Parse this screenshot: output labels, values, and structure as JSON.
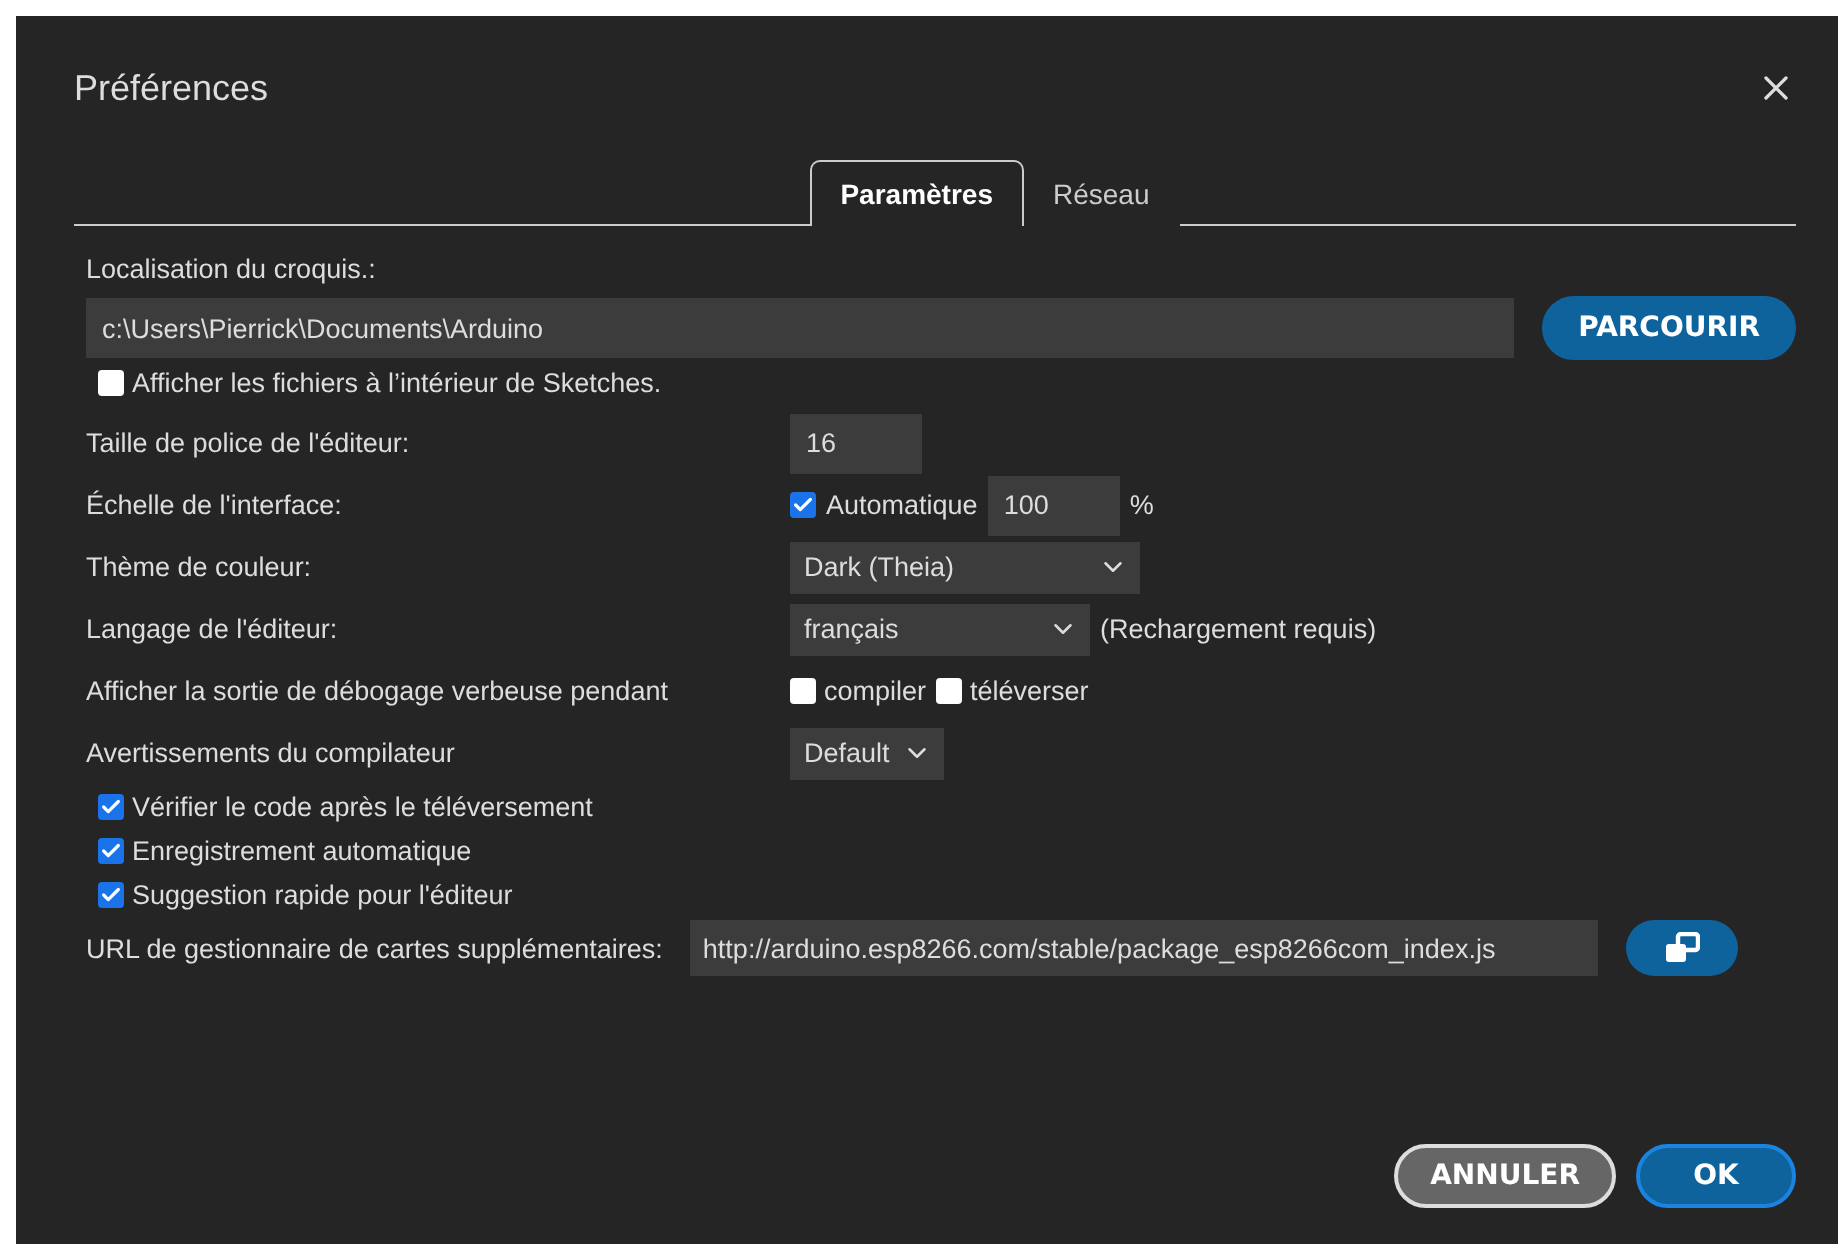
{
  "dialog": {
    "title": "Préférences"
  },
  "tabs": [
    {
      "label": "Paramètres",
      "selected": true
    },
    {
      "label": "Réseau",
      "selected": false
    }
  ],
  "sketchbook": {
    "label": "Localisation du croquis.:",
    "value": "c:\\Users\\Pierrick\\Documents\\Arduino",
    "button": "PARCOURIR"
  },
  "show_files": {
    "label": "Afficher les fichiers à l’intérieur de Sketches.",
    "checked": false
  },
  "settings": [
    {
      "kind": "number",
      "label": "Taille de police de l'éditeur:",
      "value": "16"
    },
    {
      "kind": "scale",
      "label": "Échelle de l'interface:",
      "check_label": "Automatique",
      "checked": true,
      "value": "100",
      "unit": "%"
    },
    {
      "kind": "select",
      "label": "Thème de couleur:",
      "value": "Dark (Theia)"
    },
    {
      "kind": "select",
      "label": "Langage de l'éditeur:",
      "value": "français",
      "note": "(Rechargement requis)"
    },
    {
      "kind": "checks",
      "label": "Afficher la sortie de débogage verbeuse pendant",
      "options": [
        {
          "label": "compiler",
          "checked": false
        },
        {
          "label": "téléverser",
          "checked": false
        }
      ]
    },
    {
      "kind": "select",
      "label": "Avertissements du compilateur",
      "value": "Default"
    }
  ],
  "options": [
    {
      "label": "Vérifier le code après le téléversement",
      "checked": true
    },
    {
      "label": "Enregistrement automatique",
      "checked": true
    },
    {
      "label": "Suggestion rapide pour l'éditeur",
      "checked": true
    }
  ],
  "boards_url": {
    "label": "URL de gestionnaire de cartes supplémentaires:",
    "value": "http://arduino.esp8266.com/stable/package_esp8266com_index.js"
  },
  "buttons": [
    {
      "label": "ANNULER",
      "kind": "secondary"
    },
    {
      "label": "OK",
      "kind": "primary"
    }
  ]
}
